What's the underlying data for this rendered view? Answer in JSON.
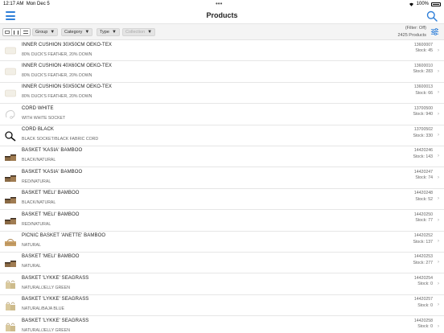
{
  "status_bar": {
    "time": "12:17 AM",
    "date": "Mon Dec 5",
    "battery": "100%"
  },
  "nav": {
    "title": "Products",
    "menu_icon": "hamburger-menu-icon",
    "search_icon": "search-icon"
  },
  "filters": {
    "group": "Group",
    "category": "Category",
    "type": "Type",
    "collection": "Collection",
    "filter_state": "(Filter: Off)",
    "product_count": "2425 Products"
  },
  "colors": {
    "accent": "#2f7fd8",
    "divider": "#e6e6e6",
    "filterbar_bg": "#f4f4f4"
  },
  "products": [
    {
      "name": "INNER CUSHION 30X50CM OEKO-TEX",
      "desc": "80% DUCK'S FEATHER, 20% DOWN",
      "code": "13600007",
      "stock": "Stock: 45",
      "icon": "cushion-icon"
    },
    {
      "name": "INNER CUSHION 40X60CM OEKO-TEX",
      "desc": "80% DUCK'S FEATHER, 20% DOWN",
      "code": "13600010",
      "stock": "Stock: 283",
      "icon": "cushion-icon"
    },
    {
      "name": "INNER CUSHION 50X50CM OEKO-TEX",
      "desc": "80% DUCK'S FEATHER, 20% DOWN",
      "code": "13600013",
      "stock": "Stock: 66",
      "icon": "cushion-icon"
    },
    {
      "name": "CORD WHITE",
      "desc": "WITH WHITE SOCKET",
      "code": "13700500",
      "stock": "Stock: 940",
      "icon": "cord-white-icon"
    },
    {
      "name": "CORD BLACK",
      "desc": "BLACK SOCKET/BLACK FABRIC CORD",
      "code": "13700502",
      "stock": "Stock: 330",
      "icon": "cord-black-icon"
    },
    {
      "name": "BASKET 'KASIA' BAMBOO",
      "desc": "BLACK/NATURAL",
      "code": "14420246",
      "stock": "Stock: 143",
      "icon": "basket-icon"
    },
    {
      "name": "BASKET 'KASIA' BAMBOO",
      "desc": "RED/NATURAL",
      "code": "14420247",
      "stock": "Stock: 74",
      "icon": "basket-icon"
    },
    {
      "name": "BASKET 'MELI' BAMBOO",
      "desc": "BLACK/NATURAL",
      "code": "14420248",
      "stock": "Stock: 52",
      "icon": "basket-icon"
    },
    {
      "name": "BASKET 'MELI' BAMBOO",
      "desc": "RED/NATURAL",
      "code": "14420250",
      "stock": "Stock: 77",
      "icon": "basket-icon"
    },
    {
      "name": "PICNIC BASKET 'ANETTE' BAMBOO",
      "desc": "NATURAL",
      "code": "14420252",
      "stock": "Stock: 137",
      "icon": "picnic-basket-icon"
    },
    {
      "name": "BASKET 'MELI' BAMBOO",
      "desc": "NATURAL",
      "code": "14420253",
      "stock": "Stock: 277",
      "icon": "basket-icon"
    },
    {
      "name": "BASKET 'LYKKE' SEAGRASS",
      "desc": "NATURAL/JELLY GREEN",
      "code": "14420254",
      "stock": "Stock: 0",
      "icon": "seagrass-basket-icon"
    },
    {
      "name": "BASKET 'LYKKE' SEAGRASS",
      "desc": "NATURAL/BAJA BLUE",
      "code": "14420257",
      "stock": "Stock: 0",
      "icon": "seagrass-basket-icon"
    },
    {
      "name": "BASKET 'LYKKE' SEAGRASS",
      "desc": "NATURAL/JELLY GREEN",
      "code": "14420258",
      "stock": "Stock: 0",
      "icon": "seagrass-basket-icon"
    }
  ]
}
